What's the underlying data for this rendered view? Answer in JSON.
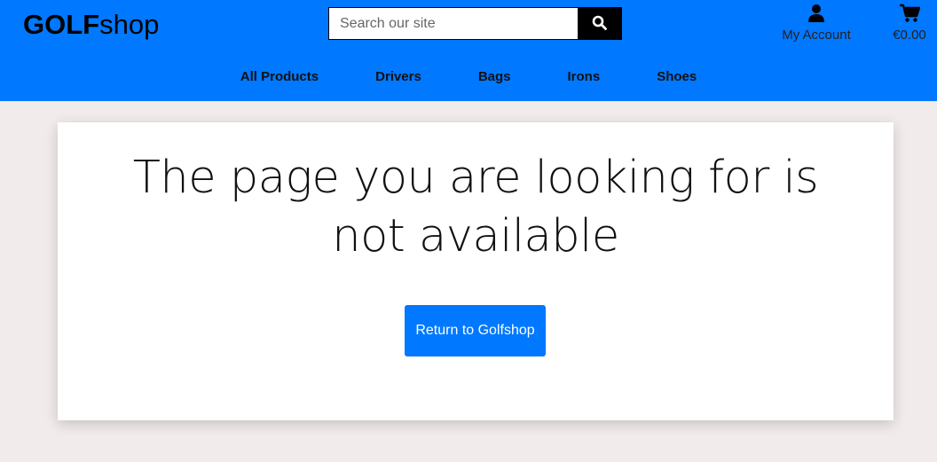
{
  "header": {
    "logo_bold": "GOLF",
    "logo_regular": "shop",
    "search": {
      "placeholder": "Search our site",
      "icon": "search-icon"
    },
    "account": {
      "label": "My Account",
      "icon": "user-icon"
    },
    "cart": {
      "total": "€0.00",
      "icon": "cart-icon"
    }
  },
  "nav": {
    "items": [
      "All Products",
      "Drivers",
      "Bags",
      "Irons",
      "Shoes"
    ]
  },
  "main": {
    "headline": "The page you are looking for is not available",
    "return_label": "Return to Golfshop"
  },
  "colors": {
    "brand": "#0078ff",
    "page_background": "#f2ebeb",
    "search_button": "#000000"
  }
}
